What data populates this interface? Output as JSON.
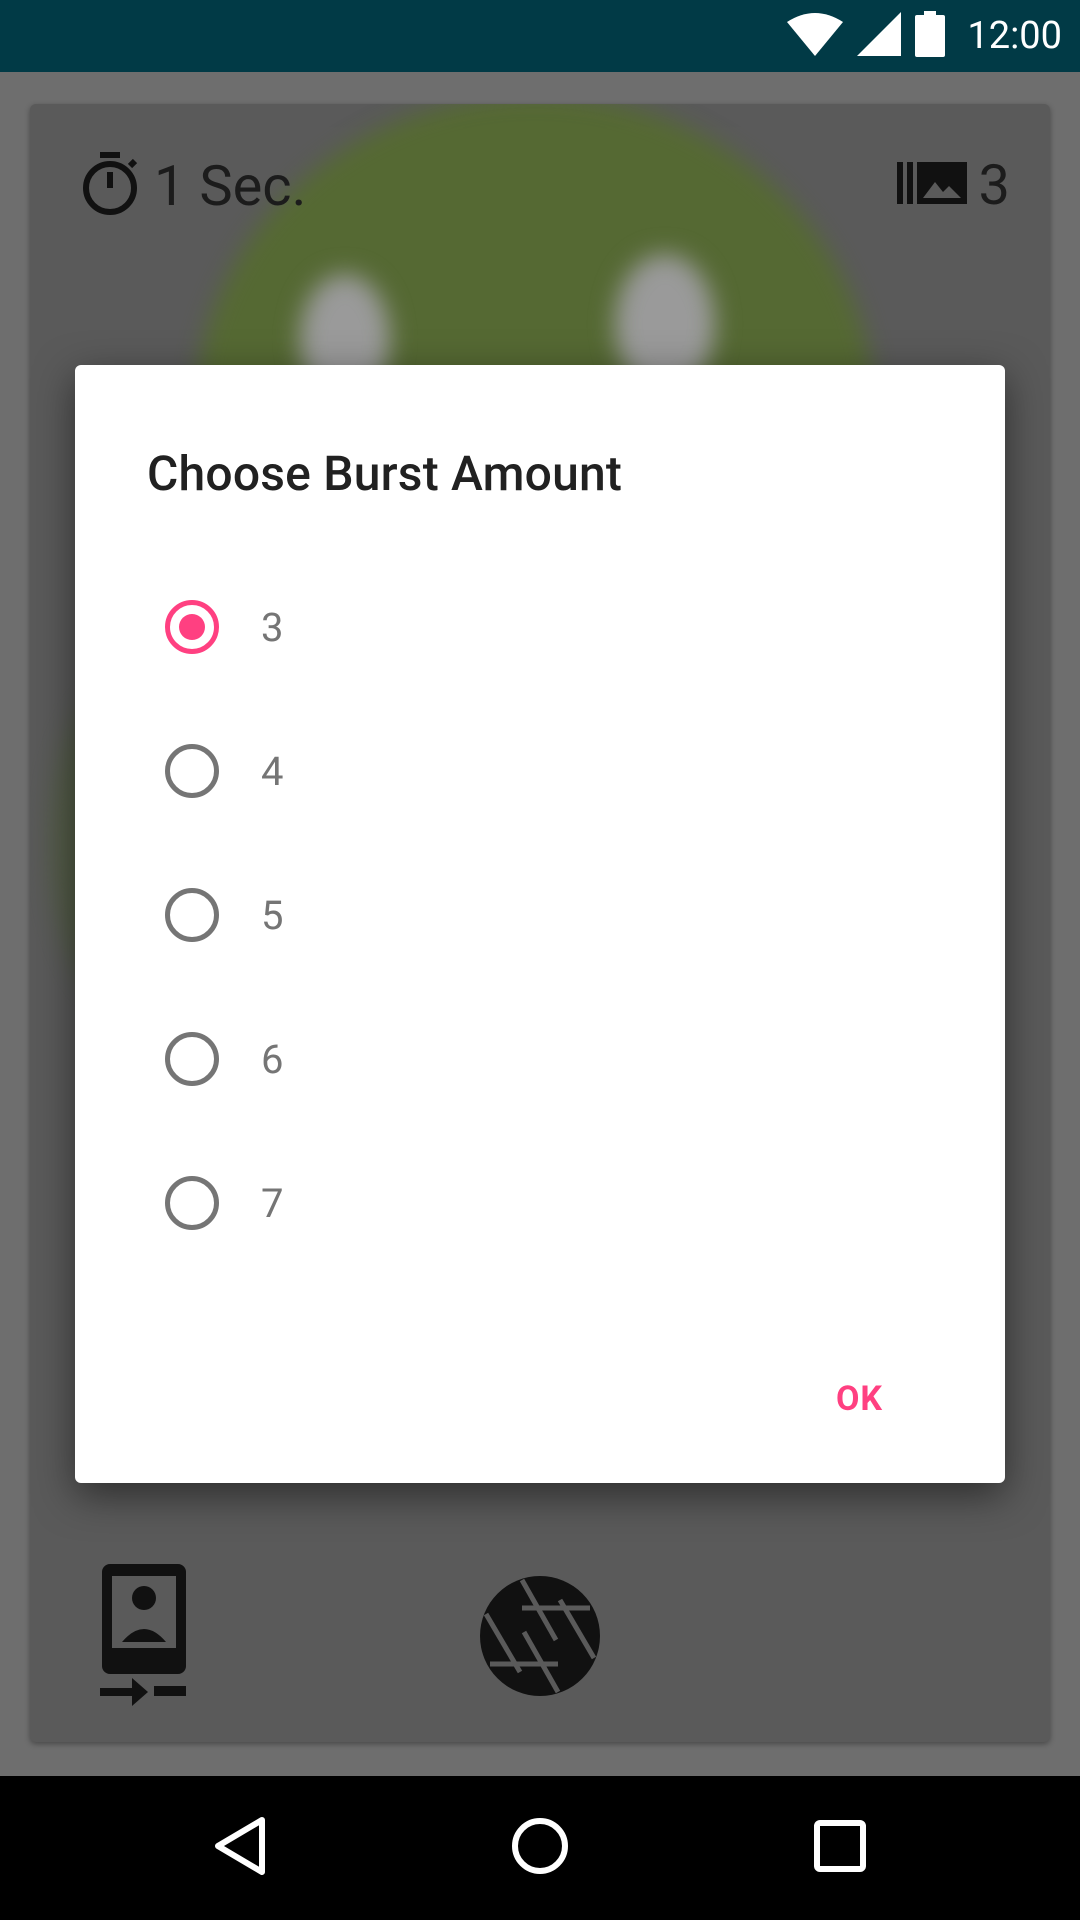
{
  "status_bar": {
    "time": "12:00",
    "icons": [
      "wifi-icon",
      "signal-icon",
      "battery-icon"
    ],
    "background": "#013a46"
  },
  "camera": {
    "timer_label": "1 Sec.",
    "burst_count": "3",
    "icons": [
      "timer-icon",
      "burst-icon",
      "switch-camera-icon",
      "shutter-icon"
    ]
  },
  "dialog": {
    "title": "Choose Burst Amount",
    "selected": "3",
    "options": [
      {
        "label": "3"
      },
      {
        "label": "4"
      },
      {
        "label": "5"
      },
      {
        "label": "6"
      },
      {
        "label": "7"
      }
    ],
    "ok_label": "OK",
    "accent_color": "#ff4081"
  },
  "nav_bar": {
    "icons": [
      "back-icon",
      "home-icon",
      "recents-icon"
    ]
  }
}
